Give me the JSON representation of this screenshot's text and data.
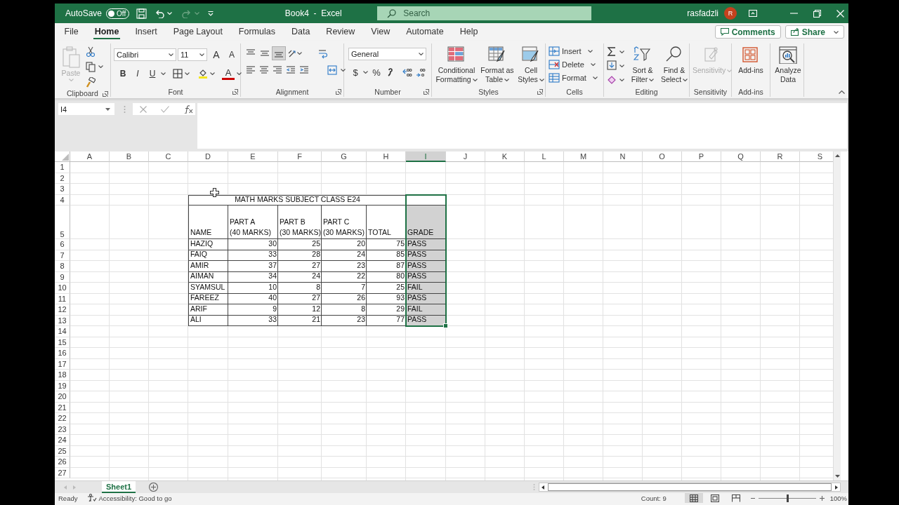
{
  "titlebar": {
    "autosave_label": "AutoSave",
    "autosave": {
      "on": false,
      "label": "Off"
    },
    "title": "Book4  -  Excel",
    "search_placeholder": "Search",
    "user": "rasfadzli",
    "avatar": "R"
  },
  "menu": {
    "tabs": [
      {
        "label": "File",
        "selected": false
      },
      {
        "label": "Home",
        "selected": true
      },
      {
        "label": "Insert",
        "selected": false
      },
      {
        "label": "Page Layout",
        "selected": false
      },
      {
        "label": "Formulas",
        "selected": false
      },
      {
        "label": "Data",
        "selected": false
      },
      {
        "label": "Review",
        "selected": false
      },
      {
        "label": "View",
        "selected": false
      },
      {
        "label": "Automate",
        "selected": false
      },
      {
        "label": "Help",
        "selected": false
      }
    ],
    "buttons": [
      "Comments",
      "Share"
    ]
  },
  "ribbon": {
    "groups": [
      {
        "kind": "clipboard",
        "label": "Clipboard",
        "paste": {
          "label": "Paste",
          "disabled": true
        }
      },
      {
        "kind": "font",
        "label": "Font",
        "font": "Calibri",
        "size": "11",
        "grow": "A",
        "shrink": "A",
        "styles": [
          "B",
          "I",
          "U"
        ],
        "color_letter": "A"
      },
      {
        "kind": "alignment",
        "label": "Alignment",
        "vertical_align": [
          {
            "selected": false
          },
          {
            "selected": false
          },
          {
            "selected": true
          }
        ]
      },
      {
        "kind": "number",
        "label": "Number",
        "format": "General",
        "currency": "$",
        "percent": "%"
      },
      {
        "kind": "styles",
        "label": "Styles",
        "buttons": [
          {
            "label": "Conditional\nFormatting",
            "dropdown": true,
            "disabled": false
          },
          {
            "label": "Format as\nTable",
            "dropdown": true,
            "disabled": false
          },
          {
            "label": "Cell\nStyles",
            "dropdown": true,
            "disabled": false
          }
        ]
      },
      {
        "kind": "cells",
        "label": "Cells",
        "buttons": [
          {
            "label": "Insert",
            "dropdown": true,
            "disabled": false
          },
          {
            "label": "Delete",
            "dropdown": true,
            "disabled": false
          },
          {
            "label": "Format",
            "dropdown": true,
            "disabled": false
          }
        ]
      },
      {
        "kind": "editing",
        "label": "Editing",
        "buttons": [
          {
            "label": "Sort &\nFilter",
            "dropdown": true,
            "disabled": false
          },
          {
            "label": "Find &\nSelect",
            "dropdown": true,
            "disabled": false
          }
        ]
      },
      {
        "kind": "sensitivity",
        "label": "Sensitivity",
        "buttons": [
          {
            "label": "Sensitivity",
            "dropdown": true,
            "disabled": true
          }
        ]
      },
      {
        "kind": "addins",
        "label": "Add-ins",
        "buttons": [
          {
            "label": "Add-ins",
            "dropdown": false,
            "disabled": false
          }
        ]
      },
      {
        "kind": "analyze",
        "buttons": [
          {
            "label": "Analyze\nData",
            "dropdown": false,
            "disabled": false
          }
        ]
      }
    ]
  },
  "formula_bar": {
    "name_box": "I4"
  },
  "sheet": {
    "columns": [
      {
        "label": "A",
        "selected": false
      },
      {
        "label": "B",
        "selected": false
      },
      {
        "label": "C",
        "selected": false
      },
      {
        "label": "D",
        "selected": false
      },
      {
        "label": "E",
        "selected": false
      },
      {
        "label": "F",
        "selected": false
      },
      {
        "label": "G",
        "selected": false
      },
      {
        "label": "H",
        "selected": false
      },
      {
        "label": "I",
        "selected": true
      },
      {
        "label": "J",
        "selected": false
      },
      {
        "label": "K",
        "selected": false
      },
      {
        "label": "L",
        "selected": false
      },
      {
        "label": "M",
        "selected": false
      },
      {
        "label": "N",
        "selected": false
      },
      {
        "label": "O",
        "selected": false
      },
      {
        "label": "P",
        "selected": false
      },
      {
        "label": "Q",
        "selected": false
      },
      {
        "label": "R",
        "selected": false
      },
      {
        "label": "S",
        "selected": false
      }
    ],
    "rows": [
      "1",
      "2",
      "3",
      "4",
      "5",
      "6",
      "7",
      "8",
      "9",
      "10",
      "11",
      "12",
      "13",
      "14",
      "15",
      "16",
      "17",
      "18",
      "19",
      "20",
      "21",
      "22",
      "23",
      "24",
      "25",
      "26",
      "27"
    ],
    "table": {
      "title": "MATH MARKS SUBJECT CLASS E24",
      "columns": [
        {
          "header": "NAME",
          "kind": "text",
          "selected": false
        },
        {
          "header": "PART A\n(40 MARKS)",
          "kind": "number",
          "selected": false
        },
        {
          "header": "PART B\n(30 MARKS)",
          "kind": "number",
          "selected": false
        },
        {
          "header": "PART C\n(30 MARKS)",
          "kind": "number",
          "selected": false
        },
        {
          "header": "TOTAL",
          "kind": "number",
          "selected": false
        },
        {
          "header": "GRADE",
          "kind": "text",
          "selected": true
        }
      ],
      "rows": [
        [
          "HAZIQ",
          "30",
          "25",
          "20",
          "75",
          "PASS"
        ],
        [
          "FAIQ",
          "33",
          "28",
          "24",
          "85",
          "PASS"
        ],
        [
          "AMIR",
          "37",
          "27",
          "23",
          "87",
          "PASS"
        ],
        [
          "AIMAN",
          "34",
          "24",
          "22",
          "80",
          "PASS"
        ],
        [
          "SYAMSUL",
          "10",
          "8",
          "7",
          "25",
          "FAIL"
        ],
        [
          "FAREEZ",
          "40",
          "27",
          "26",
          "93",
          "PASS"
        ],
        [
          "ARIF",
          "9",
          "12",
          "8",
          "29",
          "FAIL"
        ],
        [
          "ALI",
          "33",
          "21",
          "23",
          "77",
          "PASS"
        ]
      ]
    }
  },
  "sheet_tabs": [
    {
      "label": "Sheet1",
      "selected": true
    }
  ],
  "status_bar": {
    "mode": "Ready",
    "accessibility": "Accessibility: Good to go",
    "count": "Count: 9",
    "views": [
      {
        "kind": "normal",
        "selected": true
      },
      {
        "kind": "page_layout",
        "selected": false
      },
      {
        "kind": "page_break",
        "selected": false
      }
    ],
    "zoom": {
      "level": 0.5,
      "label": "100%"
    }
  }
}
